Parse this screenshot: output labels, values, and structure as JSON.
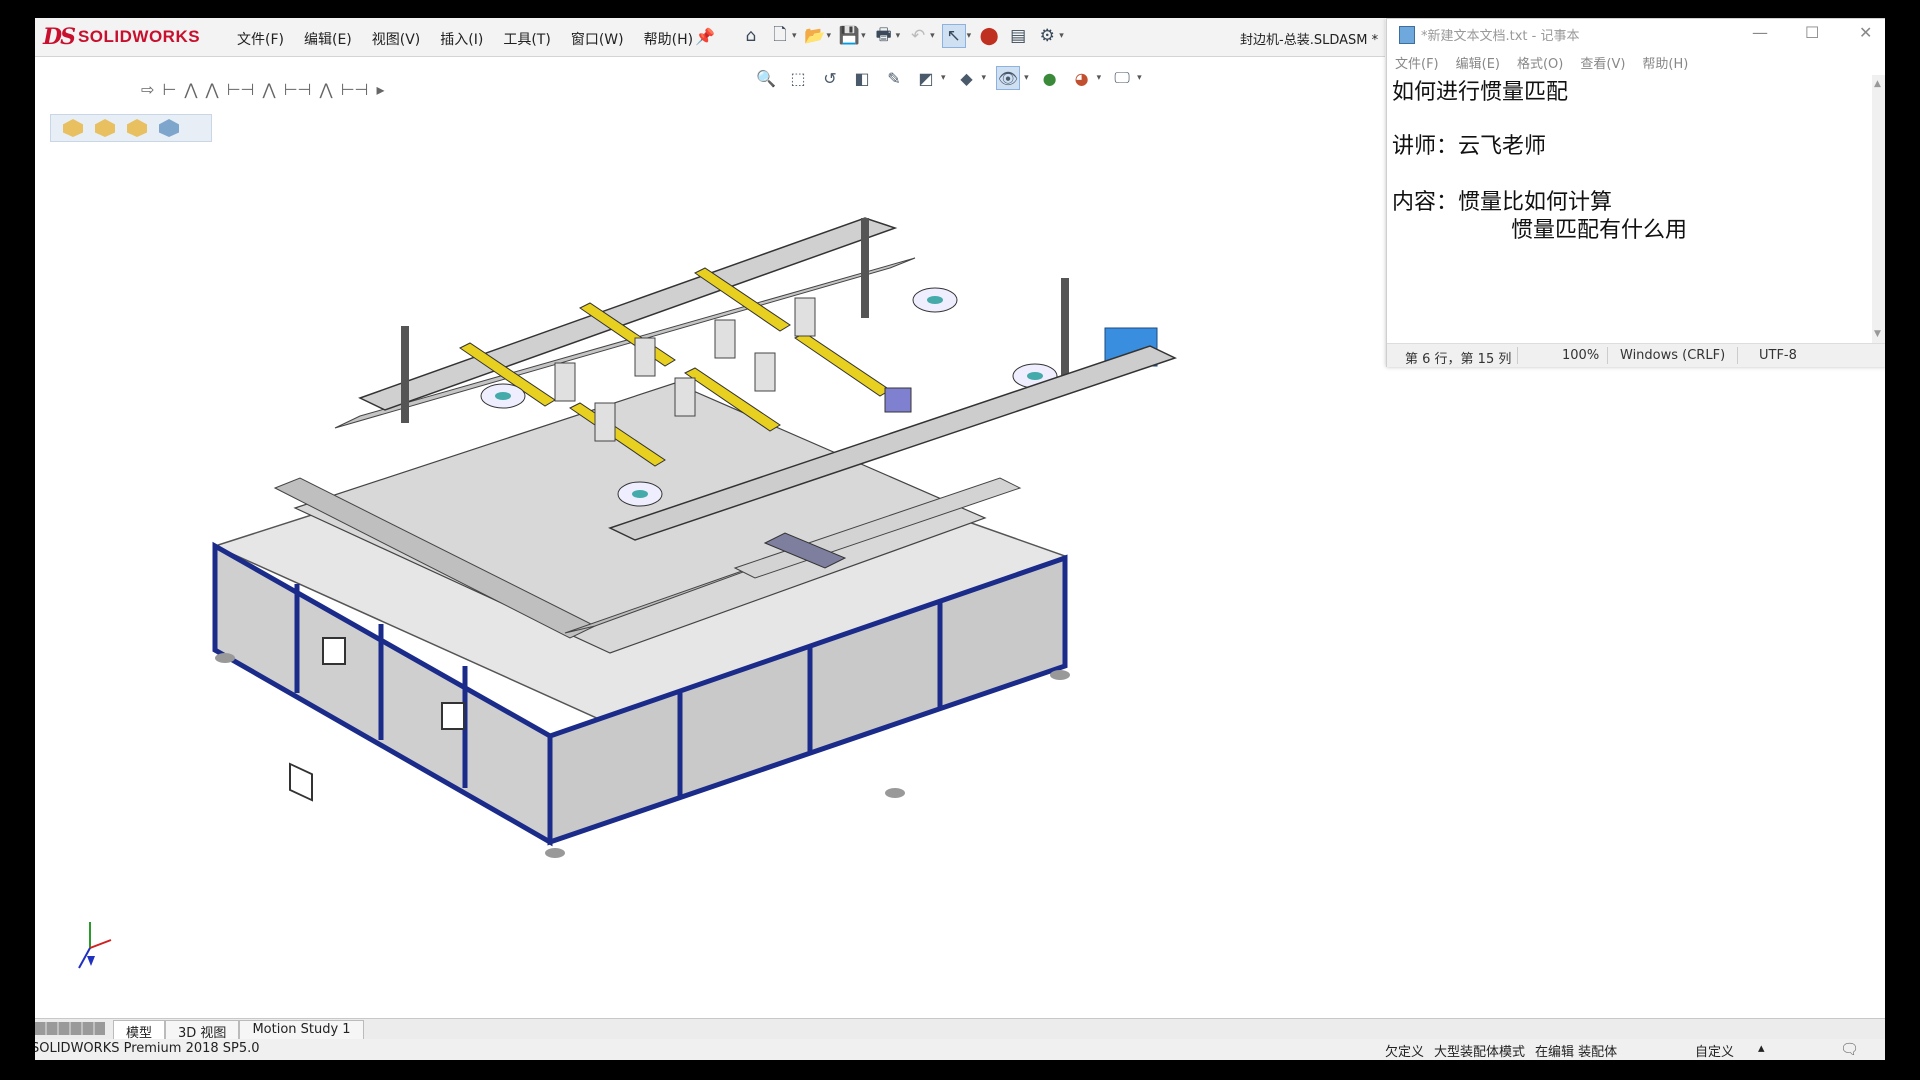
{
  "solidworks": {
    "logo_ds": "DS",
    "logo_text": "SOLIDWORKS",
    "menu": [
      "文件(F)",
      "编辑(E)",
      "视图(V)",
      "插入(I)",
      "工具(T)",
      "窗口(W)",
      "帮助(H)"
    ],
    "document_title": "封边机-总装.SLDASM *",
    "bottom_tabs": [
      "模型",
      "3D 视图",
      "Motion Study 1"
    ],
    "status_left": "SOLIDWORKS Premium 2018 SP5.0",
    "status_right": [
      "欠定义",
      "大型装配体模式",
      "在编辑 装配体"
    ],
    "status_custom": "自定义",
    "accent_color": "#c8102e"
  },
  "notepad": {
    "title": "*新建文本文档.txt - 记事本",
    "menu": [
      "文件(F)",
      "编辑(E)",
      "格式(O)",
      "查看(V)",
      "帮助(H)"
    ],
    "lines": [
      "如何进行惯量匹配",
      "",
      "讲师：云飞老师",
      "",
      "内容：惯量比如何计算",
      "      惯量匹配有什么用"
    ],
    "status_position": "第 6 行，第 15 列",
    "status_zoom": "100%",
    "status_eol": "Windows (CRLF)",
    "status_encoding": "UTF-8"
  },
  "icons": {
    "home": "home-icon",
    "new": "new-document-icon",
    "open": "open-icon",
    "save": "save-icon",
    "print": "print-icon",
    "undo": "undo-icon",
    "select": "select-pointer-icon",
    "rebuild": "traffic-light-icon",
    "options": "gear-icon"
  }
}
